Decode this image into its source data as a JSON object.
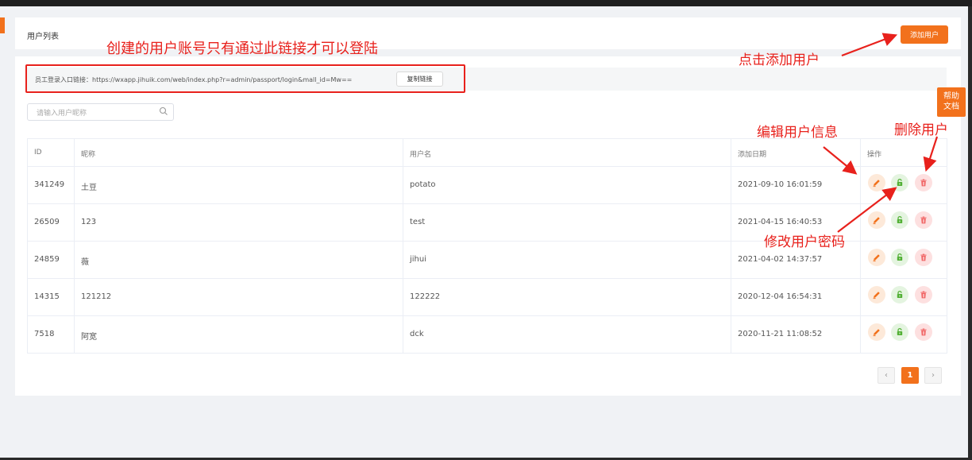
{
  "header": {
    "title": "用户列表",
    "add_button": "添加用户"
  },
  "link_bar": {
    "label_and_url": "员工登录入口链接：https://wxapp.jihuik.com/web/index.php?r=admin/passport/login&mall_id=Mw==",
    "copy_button": "复制链接"
  },
  "search": {
    "placeholder": "请输入用户昵称"
  },
  "table": {
    "columns": [
      "ID",
      "昵称",
      "用户名",
      "添加日期",
      "操作"
    ],
    "rows": [
      {
        "id": "341249",
        "nickname": "土豆",
        "username": "potato",
        "date": "2021-09-10 16:01:59"
      },
      {
        "id": "26509",
        "nickname": "123",
        "username": "test",
        "date": "2021-04-15 16:40:53"
      },
      {
        "id": "24859",
        "nickname": "薇",
        "username": "jihui",
        "date": "2021-04-02 14:37:57"
      },
      {
        "id": "14315",
        "nickname": "121212",
        "username": "122222",
        "date": "2020-12-04 16:54:31"
      },
      {
        "id": "7518",
        "nickname": "阿宽",
        "username": "dck",
        "date": "2020-11-21 11:08:52"
      }
    ]
  },
  "pagination": {
    "prev": "‹",
    "current": "1",
    "next": "›"
  },
  "help_tab": {
    "line1": "帮助",
    "line2": "文档"
  },
  "annotations": {
    "link_note": "创建的用户账号只有通过此链接才可以登陆",
    "add_note": "点击添加用户",
    "edit_note": "编辑用户信息",
    "delete_note": "删除用户",
    "password_note": "修改用户密码"
  },
  "colors": {
    "accent": "#f2711c",
    "annotation_red": "#e8211c",
    "edit": "#f2711c",
    "lock": "#52b035",
    "delete": "#f06060"
  },
  "icons": {
    "edit": "pencil-icon",
    "password": "unlock-icon",
    "delete": "trash-icon",
    "search": "search-icon"
  }
}
